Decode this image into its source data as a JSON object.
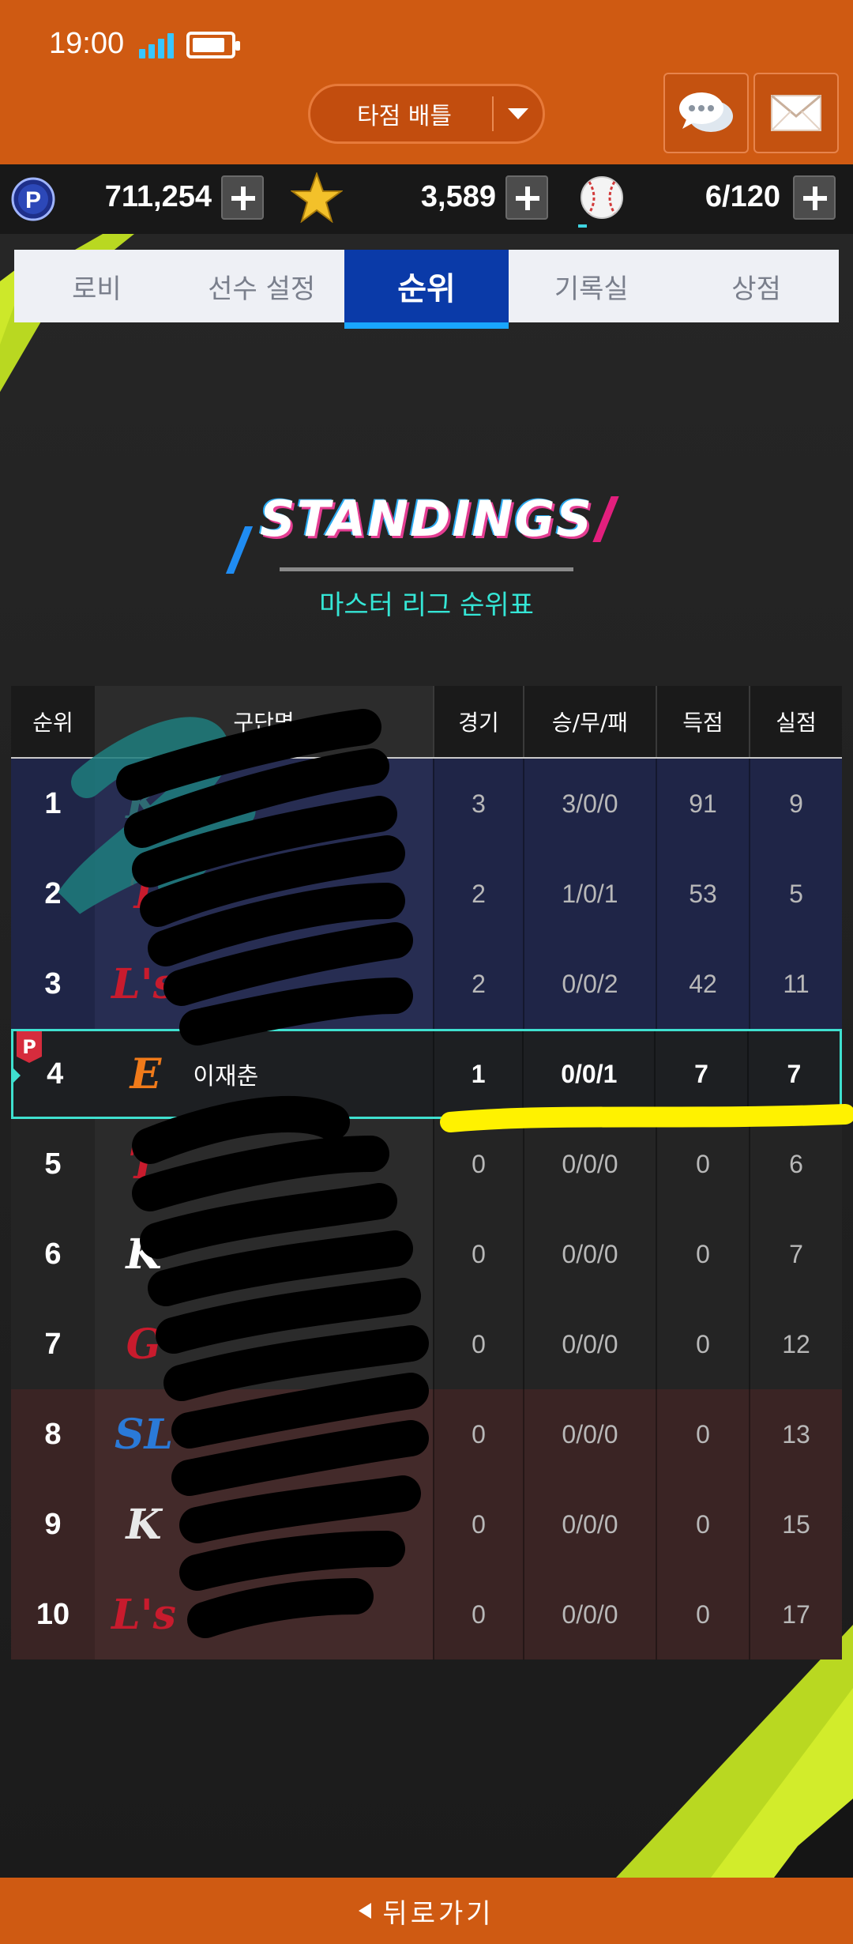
{
  "status_bar": {
    "time": "19:00"
  },
  "header": {
    "mode_label": "타점 배틀",
    "chat_icon": "chat-bubble-icon",
    "mail_icon": "mail-envelope-icon",
    "colors": {
      "bar": "#cf5a12"
    }
  },
  "currency": {
    "points": "711,254",
    "stars": "3,589",
    "balls": "6/120",
    "ball_fill_fraction": 0.05
  },
  "tabs": [
    {
      "label": "로비",
      "active": false
    },
    {
      "label": "선수 설정",
      "active": false
    },
    {
      "label": "순위",
      "active": true
    },
    {
      "label": "기록실",
      "active": false
    },
    {
      "label": "상점",
      "active": false
    }
  ],
  "standings": {
    "title": "STANDINGS",
    "subtitle": "마스터 리그 순위표",
    "columns": [
      "순위",
      "구단명",
      "경기",
      "승/무/패",
      "득점",
      "실점"
    ],
    "rows": [
      {
        "rank": "1",
        "logo": "K",
        "logo_color": "#2f6b73",
        "team": "",
        "games": "3",
        "wdl": "3/0/0",
        "rs": "91",
        "ra": "9",
        "tier": "top"
      },
      {
        "rank": "2",
        "logo": "T",
        "logo_color": "#c81b2d",
        "team": "",
        "games": "2",
        "wdl": "1/0/1",
        "rs": "53",
        "ra": "5",
        "tier": "top"
      },
      {
        "rank": "3",
        "logo": "L's",
        "logo_color": "#c81b2d",
        "team": "",
        "games": "2",
        "wdl": "0/0/2",
        "rs": "42",
        "ra": "11",
        "tier": "top"
      },
      {
        "rank": "4",
        "logo": "E",
        "logo_color": "#f07a1a",
        "team": "이재춘",
        "games": "1",
        "wdl": "0/0/1",
        "rs": "7",
        "ra": "7",
        "tier": "me"
      },
      {
        "rank": "5",
        "logo": "T",
        "logo_color": "#c81b2d",
        "team": "",
        "games": "0",
        "wdl": "0/0/0",
        "rs": "0",
        "ra": "6",
        "tier": "mid"
      },
      {
        "rank": "6",
        "logo": "K",
        "logo_color": "#ffffff",
        "team": "",
        "games": "0",
        "wdl": "0/0/0",
        "rs": "0",
        "ra": "7",
        "tier": "mid"
      },
      {
        "rank": "7",
        "logo": "G",
        "logo_color": "#c81b2d",
        "team": "",
        "games": "0",
        "wdl": "0/0/0",
        "rs": "0",
        "ra": "12",
        "tier": "mid"
      },
      {
        "rank": "8",
        "logo": "SL",
        "logo_color": "#2a7ad8",
        "team": "",
        "games": "0",
        "wdl": "0/0/0",
        "rs": "0",
        "ra": "13",
        "tier": "low"
      },
      {
        "rank": "9",
        "logo": "K",
        "logo_color": "#e8e8e8",
        "team": "",
        "games": "0",
        "wdl": "0/0/0",
        "rs": "0",
        "ra": "15",
        "tier": "low"
      },
      {
        "rank": "10",
        "logo": "L's",
        "logo_color": "#c81b2d",
        "team": "",
        "games": "0",
        "wdl": "0/0/0",
        "rs": "0",
        "ra": "17",
        "tier": "low"
      }
    ]
  },
  "footer": {
    "back_label": "뒤로가기"
  }
}
